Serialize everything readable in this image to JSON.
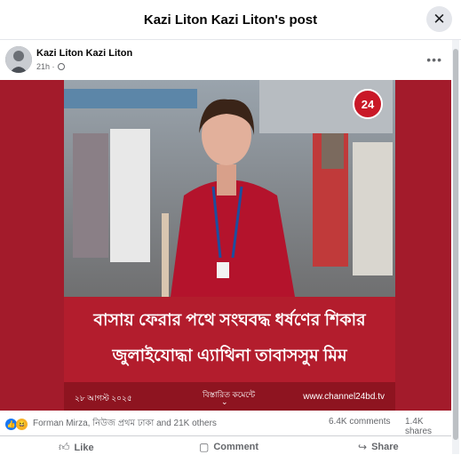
{
  "dialog": {
    "title": "Kazi Liton Kazi Liton's post",
    "close_icon": "close-icon"
  },
  "post": {
    "author": "Kazi Liton Kazi Liton",
    "time": "21h ·",
    "privacy_icon": "globe-icon",
    "more_icon": "more-icon",
    "more_label": "•••"
  },
  "media": {
    "logo_text": "24",
    "headline_line1": "বাসায় ফেরার পথে সংঘবদ্ধ ধর্ষণের শিকার",
    "headline_line2": "জুলাইযোদ্ধা এ্যাথিনা তাবাসসুম মিম",
    "date": "২৮ আগস্ট ২০২৫",
    "details": "বিস্তারিত কমেন্টে",
    "details_arrow": "⌄",
    "site": "www.channel24bd.tv"
  },
  "stats": {
    "reaction_names": "Forman Mirza, নিউজ প্রথম ঢাকা and 21K others",
    "comments": "6.4K comments",
    "shares": "1.4K shares"
  },
  "actions": {
    "like": "Like",
    "comment": "Comment",
    "share": "Share"
  },
  "colors": {
    "frame": "#a31b2b",
    "headline_bg": "#b31d2d",
    "like_blue": "#1877f2"
  }
}
